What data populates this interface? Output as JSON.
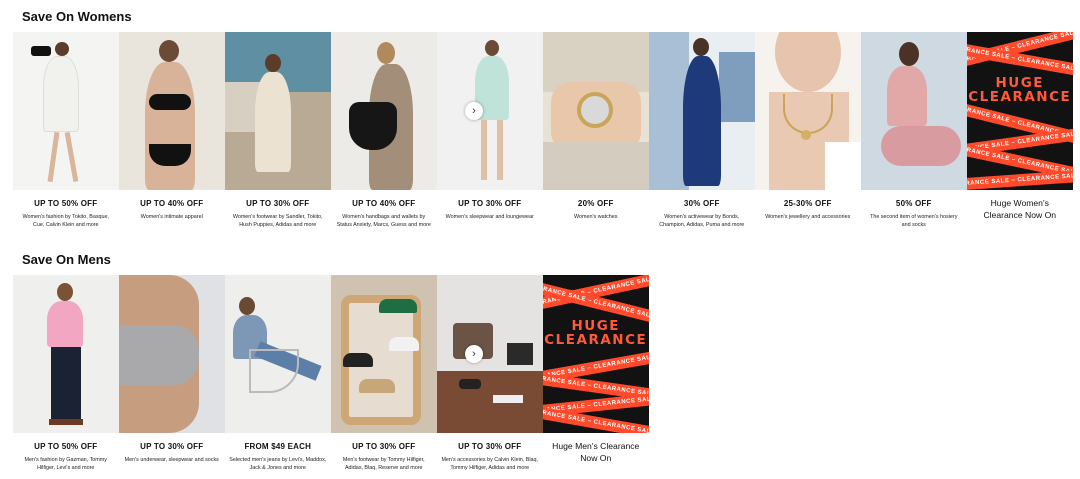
{
  "womens": {
    "title": "Save On Womens",
    "tiles": [
      {
        "offer": "UP TO 50% OFF",
        "desc": "Women's fashion by Tokito, Basque, Cue, Calvin Klein and more"
      },
      {
        "offer": "UP TO 40% OFF",
        "desc": "Women's intimate apparel"
      },
      {
        "offer": "UP TO 30% OFF",
        "desc": "Women's footwear by Sandler, Tokito, Hush Puppies, Adidas and more"
      },
      {
        "offer": "UP TO 40% OFF",
        "desc": "Women's handbags and wallets by Status Anxiety, Marcs, Guess and more"
      },
      {
        "offer": "UP TO 30% OFF",
        "desc": "Women's sleepwear and loungewear"
      },
      {
        "offer": "20% OFF",
        "desc": "Women's watches"
      },
      {
        "offer": "30% OFF",
        "desc": "Women's activewear by Bonds, Champion, Adidas, Puma and more"
      },
      {
        "offer": "25-30% OFF",
        "desc": "Women's jewellery and accessories"
      },
      {
        "offer": "50% OFF",
        "desc": "The second item of women's hosiery and socks"
      }
    ],
    "clearance": {
      "heading_line1": "HUGE",
      "heading_line2": "CLEARANCE",
      "tape_text": "CLEARANCE SALE – CLEARANCE SALE – CLEARANCE SALE",
      "caption": "Huge Women's Clearance Now On"
    }
  },
  "mens": {
    "title": "Save On Mens",
    "tiles": [
      {
        "offer": "UP TO 50% OFF",
        "desc": "Men's fashion by Gazman, Tommy Hilfiger, Levi's and more"
      },
      {
        "offer": "UP TO 30% OFF",
        "desc": "Men's underwear, sleepwear and socks"
      },
      {
        "offer": "FROM $49 EACH",
        "desc": "Selected men's jeans by Levi's, Maddox, Jack & Jones and more"
      },
      {
        "offer": "UP TO 30% OFF",
        "desc": "Men's footwear by Tommy Hilfiger, Adidas, Blaq, Reserve and more"
      },
      {
        "offer": "UP TO 30% OFF",
        "desc": "Men's accessories by Calvin Klein, Blaq, Tommy Hilfiger, Adidas and more"
      }
    ],
    "clearance": {
      "heading_line1": "HUGE",
      "heading_line2": "CLEARANCE",
      "tape_text": "CLEARANCE SALE – CLEARANCE SALE – CLEARANCE SALE",
      "caption": "Huge Men's Clearance Now On"
    }
  },
  "icons": {
    "next": "chevron-right-icon"
  },
  "colors": {
    "accent": "#ff4b2b",
    "clearance_bg": "#121212"
  }
}
